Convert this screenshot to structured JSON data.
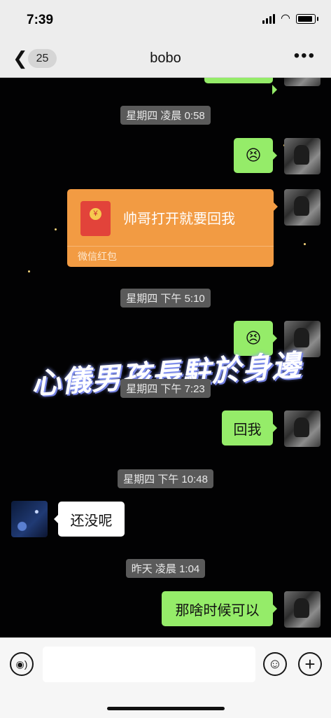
{
  "status_bar": {
    "time": "7:39"
  },
  "nav": {
    "back_count": "25",
    "title": "bobo"
  },
  "messages": [
    {
      "type": "timestamp",
      "text": "星期四 凌晨 0:58"
    },
    {
      "type": "sent",
      "emoji": "😣"
    },
    {
      "type": "sent_red_packet",
      "text": "帅哥打开就要回我",
      "label": "微信红包"
    },
    {
      "type": "timestamp",
      "text": "星期四 下午 5:10"
    },
    {
      "type": "sent",
      "emoji": "😣"
    },
    {
      "type": "timestamp",
      "text": "星期四 下午 7:23"
    },
    {
      "type": "sent",
      "text": "回我"
    },
    {
      "type": "timestamp",
      "text": "星期四 下午 10:48"
    },
    {
      "type": "received",
      "text": "还没呢"
    },
    {
      "type": "timestamp",
      "text": "昨天 凌晨 1:04"
    },
    {
      "type": "sent",
      "text": "那啥时候可以"
    }
  ],
  "background_text": "心儀男孩長駐於身邊",
  "input": {
    "placeholder": ""
  },
  "icons": {
    "back": "chevron-left-icon",
    "more": "more-dots-icon",
    "voice": "voice-icon",
    "emoji": "emoji-icon",
    "plus": "plus-icon"
  },
  "colors": {
    "sent_bubble": "#95ec69",
    "received_bubble": "#ffffff",
    "red_packet": "#f29b43"
  }
}
